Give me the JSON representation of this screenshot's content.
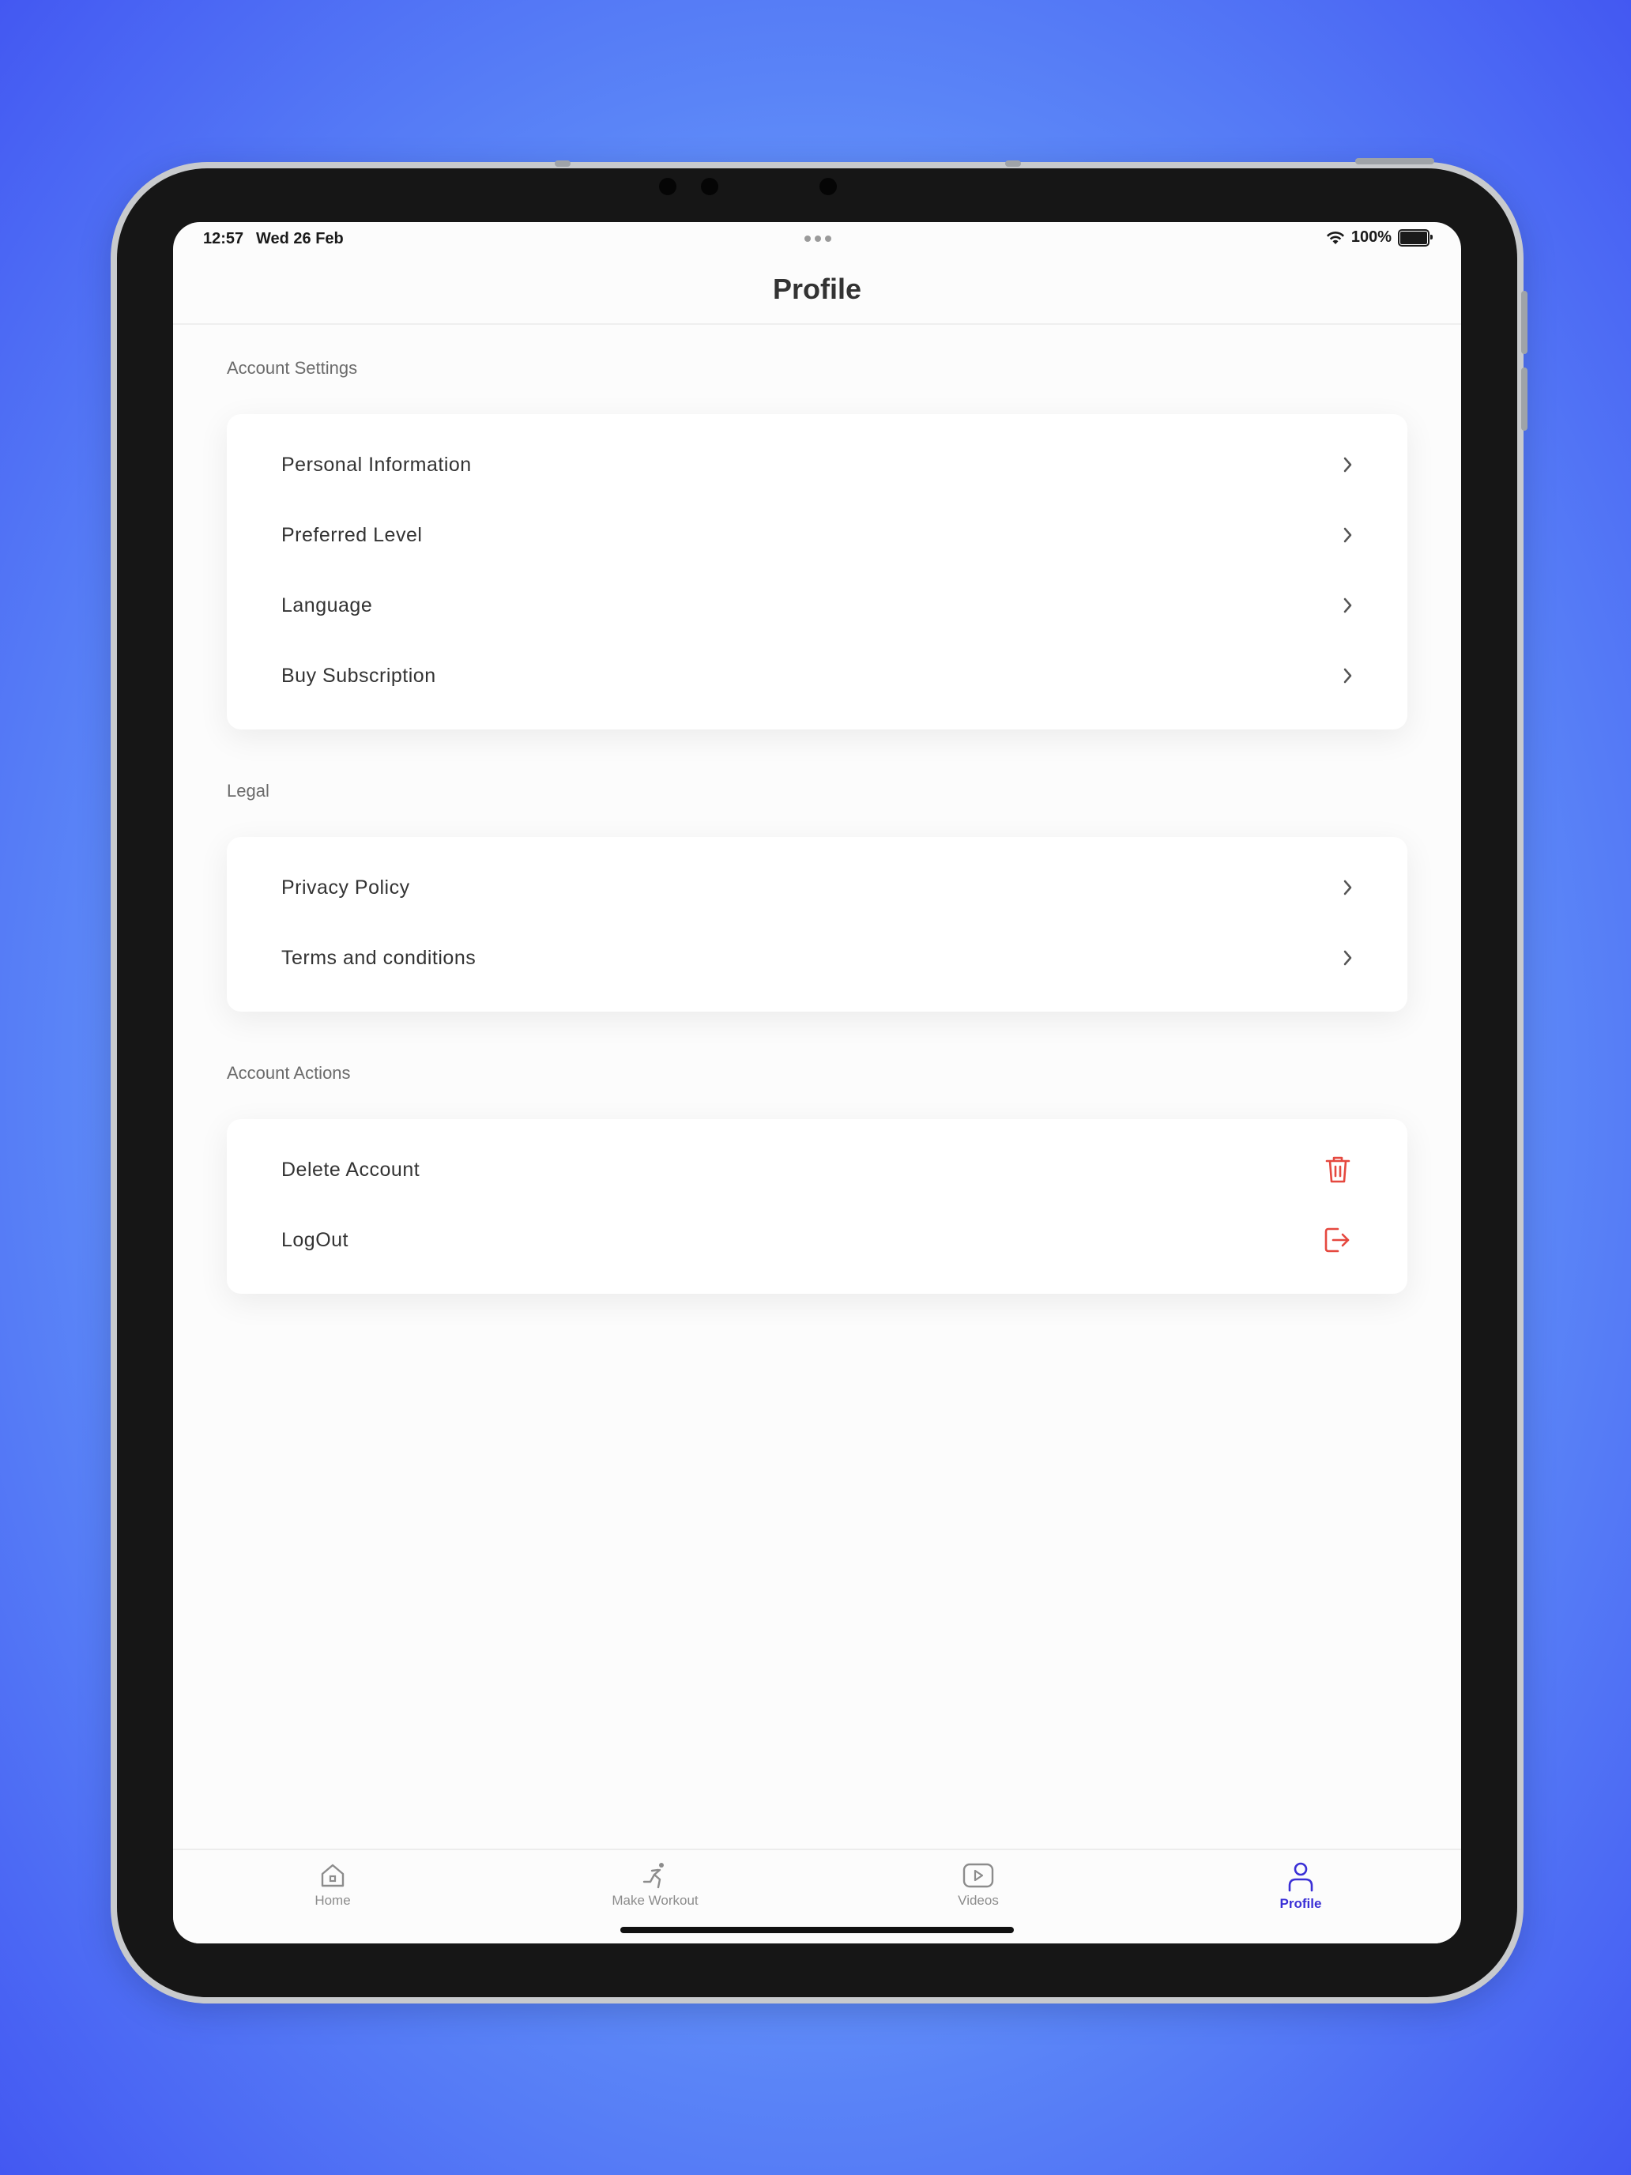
{
  "status_bar": {
    "time": "12:57",
    "date": "Wed 26 Feb",
    "battery": "100%"
  },
  "header": {
    "title": "Profile"
  },
  "sections": {
    "account_settings": {
      "label": "Account Settings",
      "items": [
        {
          "label": "Personal Information",
          "icon": "chevron-right-icon"
        },
        {
          "label": "Preferred Level",
          "icon": "chevron-right-icon"
        },
        {
          "label": "Language",
          "icon": "chevron-right-icon"
        },
        {
          "label": "Buy Subscription",
          "icon": "chevron-right-icon"
        }
      ]
    },
    "legal": {
      "label": "Legal",
      "items": [
        {
          "label": "Privacy Policy",
          "icon": "chevron-right-icon"
        },
        {
          "label": "Terms and conditions",
          "icon": "chevron-right-icon"
        }
      ]
    },
    "account_actions": {
      "label": "Account Actions",
      "items": [
        {
          "label": "Delete Account",
          "icon": "trash-icon"
        },
        {
          "label": "LogOut",
          "icon": "logout-icon"
        }
      ]
    }
  },
  "tabbar": {
    "tabs": [
      {
        "label": "Home",
        "icon": "home-icon",
        "active": false
      },
      {
        "label": "Make Workout",
        "icon": "workout-icon",
        "active": false
      },
      {
        "label": "Videos",
        "icon": "video-icon",
        "active": false
      },
      {
        "label": "Profile",
        "icon": "person-icon",
        "active": true
      }
    ]
  },
  "colors": {
    "accent": "#3a2fd6",
    "danger": "#e5483f",
    "text": "#333333"
  }
}
